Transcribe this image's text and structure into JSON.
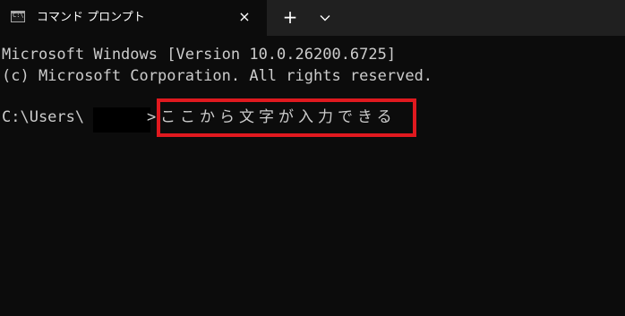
{
  "window": {
    "tab_title": "コマンド プロンプト",
    "tab_icon": "cmd-icon",
    "close_icon": "×",
    "new_tab_icon": "+",
    "dropdown_icon": "chevron-down-icon"
  },
  "terminal": {
    "line1": "Microsoft Windows [Version 10.0.26200.6725]",
    "line2": "(c) Microsoft Corporation. All rights reserved.",
    "prompt_prefix": "C:\\Users\\",
    "prompt_suffix": ">",
    "input_text": "ここから文字が入力できる"
  },
  "colors": {
    "background": "#0c0c0c",
    "titlebar": "#202020",
    "text": "#cccccc",
    "highlight_border": "#e0191f"
  }
}
